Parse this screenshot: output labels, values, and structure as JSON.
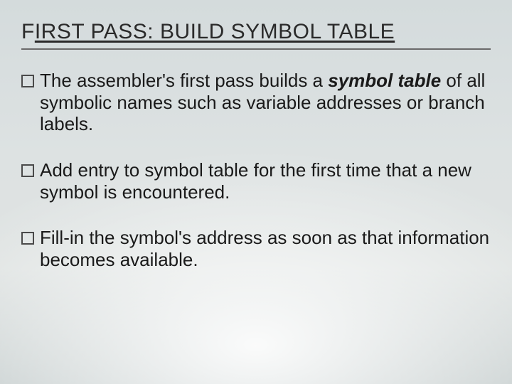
{
  "slide": {
    "title_plain": "FIRST PASS: BUILD SYMBOL TABLE",
    "title_pre": "F",
    "title_uline": "IRST PASS: BUILD SYMBOL TABLE",
    "bullets": [
      {
        "lead": "The",
        "rest_before_em": " assembler's first pass builds a ",
        "em": "symbol table",
        "rest_after_em": " of all symbolic names such as variable addresses or branch labels."
      },
      {
        "lead": "Add",
        "rest_before_em": " entry to symbol table for the first time that a new symbol is encountered.",
        "em": "",
        "rest_after_em": ""
      },
      {
        "lead": "Fill-in",
        "rest_before_em": " the symbol's address as soon as that information becomes available.",
        "em": "",
        "rest_after_em": ""
      }
    ]
  }
}
